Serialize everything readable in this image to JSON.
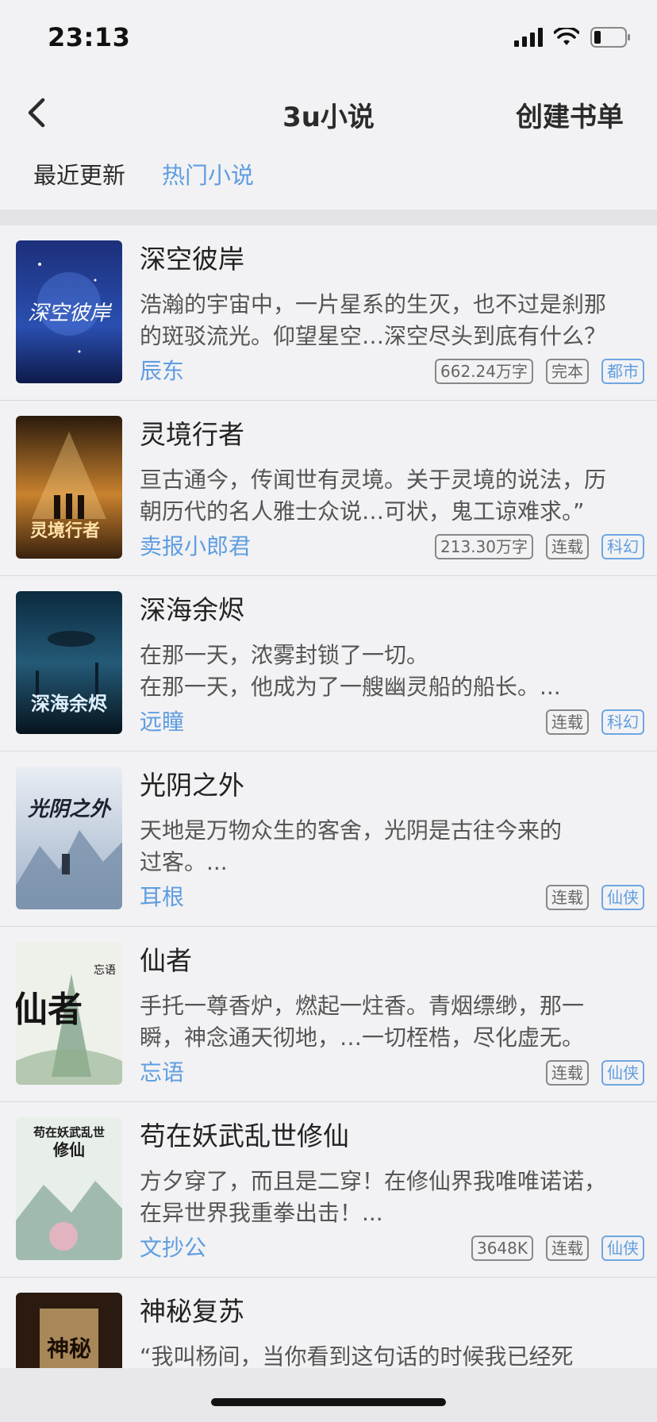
{
  "status": {
    "time": "23:13"
  },
  "nav": {
    "title": "3u小说",
    "create": "创建书单"
  },
  "tabs": [
    "最近更新",
    "热门小说"
  ],
  "books": [
    {
      "title": "深空彼岸",
      "desc1": "浩瀚的宇宙中，一片星系的生灭，也不过是刹那",
      "desc2": "的斑驳流光。仰望星空…深空尽头到底有什么？",
      "author": "辰东",
      "words": "662.24万字",
      "state": "完本",
      "genre": "都市"
    },
    {
      "title": "灵境行者",
      "desc1": "亘古通今，传闻世有灵境。关于灵境的说法，历",
      "desc2": "朝历代的名人雅士众说…可状，鬼工谅难求。”",
      "author": "卖报小郎君",
      "words": "213.30万字",
      "state": "连载",
      "genre": "科幻"
    },
    {
      "title": "深海余烬",
      "desc1": "在那一天，浓雾封锁了一切。",
      "desc2": "在那一天，他成为了一艘幽灵船的船长。...",
      "author": "远瞳",
      "words": "",
      "state": "连载",
      "genre": "科幻"
    },
    {
      "title": "光阴之外",
      "desc1": "天地是万物众生的客舍，光阴是古往今来的",
      "desc2": "过客。...",
      "author": "耳根",
      "words": "",
      "state": "连载",
      "genre": "仙侠"
    },
    {
      "title": "仙者",
      "desc1": "手托一尊香炉，燃起一炷香。青烟缥缈，那一",
      "desc2": "瞬，神念通天彻地，…一切桎梏，尽化虚无。",
      "author": "忘语",
      "words": "",
      "state": "连载",
      "genre": "仙侠"
    },
    {
      "title": "苟在妖武乱世修仙",
      "desc1": "方夕穿了，而且是二穿！在修仙界我唯唯诺诺，",
      "desc2": "在异世界我重拳出击！...",
      "author": "文抄公",
      "words": "3648K",
      "state": "连载",
      "genre": "仙侠"
    },
    {
      "title": "神秘复苏",
      "desc1": "“我叫杨间，当你看到这句话的时候我已经死",
      "desc2": "",
      "author": "",
      "words": "",
      "state": "",
      "genre": ""
    }
  ],
  "covers": {
    "c1": "深空彼岸",
    "c2": "灵境行者",
    "c3": "深海余烬",
    "c4": "光阴之外",
    "c5": "仙者",
    "c5b": "忘语",
    "c6a": "苟在妖武乱世",
    "c6b": "修仙",
    "c7": "神秘"
  }
}
